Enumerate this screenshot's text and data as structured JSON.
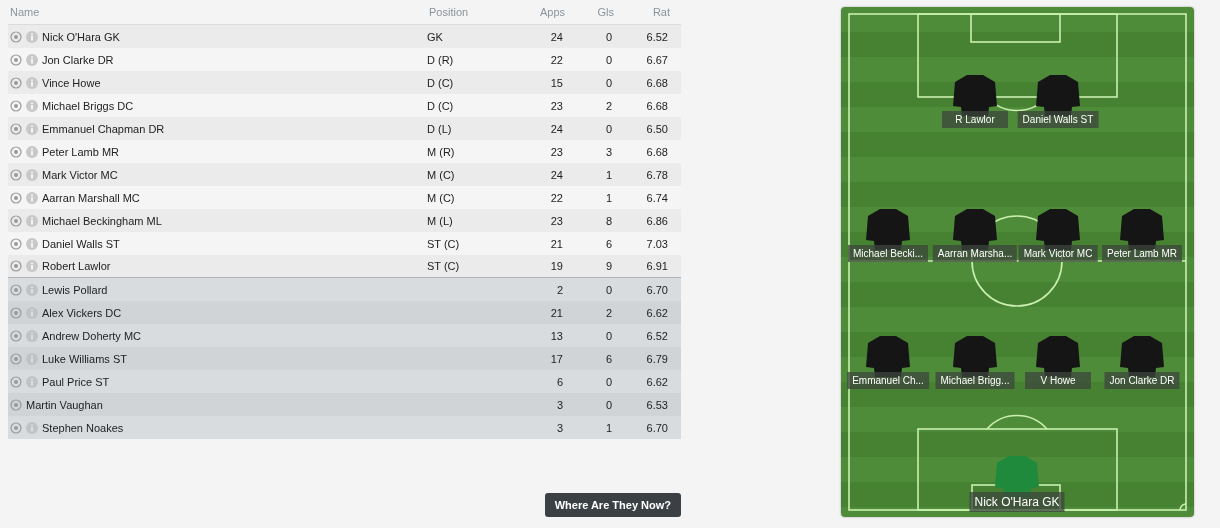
{
  "table": {
    "columns": [
      "Name",
      "Position",
      "Apps",
      "Gls",
      "Rat"
    ],
    "starters": [
      {
        "name": "Nick O'Hara GK",
        "position": "GK",
        "apps": "24",
        "gls": "0",
        "rat": "6.52",
        "info": true
      },
      {
        "name": "Jon Clarke DR",
        "position": "D (R)",
        "apps": "22",
        "gls": "0",
        "rat": "6.67",
        "info": true
      },
      {
        "name": "Vince Howe",
        "position": "D (C)",
        "apps": "15",
        "gls": "0",
        "rat": "6.68",
        "info": true
      },
      {
        "name": "Michael Briggs DC",
        "position": "D (C)",
        "apps": "23",
        "gls": "2",
        "rat": "6.68",
        "info": true
      },
      {
        "name": "Emmanuel Chapman DR",
        "position": "D (L)",
        "apps": "24",
        "gls": "0",
        "rat": "6.50",
        "info": true
      },
      {
        "name": "Peter Lamb MR",
        "position": "M (R)",
        "apps": "23",
        "gls": "3",
        "rat": "6.68",
        "info": true
      },
      {
        "name": "Mark Victor MC",
        "position": "M (C)",
        "apps": "24",
        "gls": "1",
        "rat": "6.78",
        "info": true
      },
      {
        "name": "Aarran Marshall MC",
        "position": "M (C)",
        "apps": "22",
        "gls": "1",
        "rat": "6.74",
        "info": true
      },
      {
        "name": "Michael Beckingham ML",
        "position": "M (L)",
        "apps": "23",
        "gls": "8",
        "rat": "6.86",
        "info": true
      },
      {
        "name": "Daniel Walls ST",
        "position": "ST (C)",
        "apps": "21",
        "gls": "6",
        "rat": "7.03",
        "info": true
      },
      {
        "name": "Robert Lawlor",
        "position": "ST (C)",
        "apps": "19",
        "gls": "9",
        "rat": "6.91",
        "info": true
      }
    ],
    "substitutes": [
      {
        "name": "Lewis Pollard",
        "apps": "2",
        "gls": "0",
        "rat": "6.70",
        "info": true
      },
      {
        "name": "Alex Vickers DC",
        "apps": "21",
        "gls": "2",
        "rat": "6.62",
        "info": true
      },
      {
        "name": "Andrew Doherty MC",
        "apps": "13",
        "gls": "0",
        "rat": "6.52",
        "info": true
      },
      {
        "name": "Luke Williams ST",
        "apps": "17",
        "gls": "6",
        "rat": "6.79",
        "info": true
      },
      {
        "name": "Paul Price ST",
        "apps": "6",
        "gls": "0",
        "rat": "6.62",
        "info": true
      },
      {
        "name": "Martin Vaughan",
        "apps": "3",
        "gls": "0",
        "rat": "6.53",
        "info": false
      },
      {
        "name": "Stephen Noakes",
        "apps": "3",
        "gls": "1",
        "rat": "6.70",
        "info": true
      }
    ]
  },
  "button": "Where Are They Now?",
  "pitch": {
    "players": [
      {
        "name": "R Lawlor",
        "kind": "outfield"
      },
      {
        "name": "Daniel Walls ST",
        "kind": "outfield"
      },
      {
        "name": "Michael Becki...",
        "kind": "outfield"
      },
      {
        "name": "Aarran Marsha...",
        "kind": "outfield"
      },
      {
        "name": "Mark Victor MC",
        "kind": "outfield"
      },
      {
        "name": "Peter Lamb MR",
        "kind": "outfield"
      },
      {
        "name": "Emmanuel Ch...",
        "kind": "outfield"
      },
      {
        "name": "Michael Brigg...",
        "kind": "outfield"
      },
      {
        "name": "V Howe",
        "kind": "outfield"
      },
      {
        "name": "Jon Clarke DR",
        "kind": "outfield"
      },
      {
        "name": "Nick O'Hara GK",
        "kind": "goalkeeper"
      }
    ]
  }
}
